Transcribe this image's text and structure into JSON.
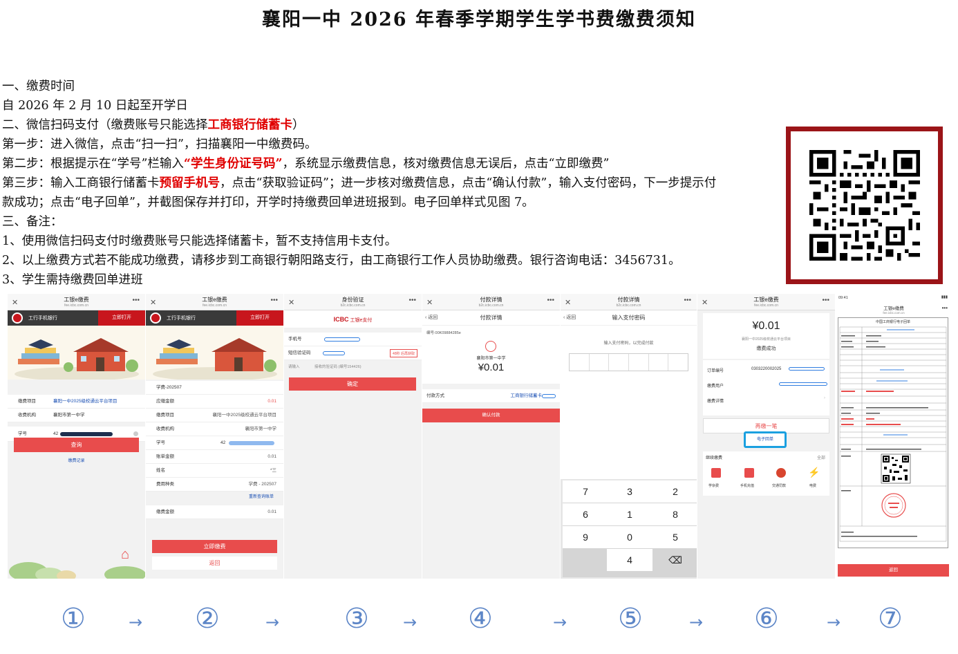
{
  "title": "襄阳一中 2026 年春季学期学生学书费缴费须知",
  "lines": {
    "l1": "一、缴费时间",
    "l2": "自 2026 年 2 月 10 日起至开学日",
    "l3a": " 二、微信扫码支付（缴费账号只能选择",
    "l3b": "工商银行储蓄卡",
    "l3c": "）",
    "l4": "第一步：进入微信，点击“扫一扫”，扫描襄阳一中缴费码。",
    "l5a": "第二步：根据提示在“学号”栏输入",
    "l5b": "“学生身份证号码”",
    "l5c": "，系统显示缴费信息，核对缴费信息无误后，点击“立即缴费”",
    "l6a": "第三步：输入工商银行储蓄卡",
    "l6b": "预留手机号",
    "l6c": "，点击“获取验证码”；进一步核对缴费信息，点击“确认付款”，输入支付密码，下一步提示付",
    "l7": "款成功；点击“电子回单”，并截图保存并打印，开学时持缴费回单进班报到。电子回单样式见图 7。",
    "l8": " 三、备注：",
    "l9": " 1、使用微信扫码支付时缴费账号只能选择储蓄卡，暂不支持信用卡支付。",
    "l10": " 2、以上缴费方式若不能成功缴费，请移步到工商银行朝阳路支行，由工商银行工作人员协助缴费。银行咨询电话：3456731。",
    "l11": " 3、学生需持缴费回单进班"
  },
  "phones": {
    "p1": {
      "title": "工银e缴费",
      "sub": "fee.icbc.com.cn",
      "bank": "工行手机银行",
      "open": "立即打开",
      "r1k": "缴费项目",
      "r1v": "襄阳一中2025级校通云平台项目",
      "r2k": "收费机构",
      "r2v": "襄阳市第一中学",
      "r3k": "学号",
      "r3v": "42",
      "btn": "查询",
      "link": "缴费记录"
    },
    "p2": {
      "title": "工银e缴费",
      "sub": "fee.icbc.com.cn",
      "bank": "工行手机银行",
      "open": "立即打开",
      "r0": "学费-202507",
      "r1k": "应缴金额",
      "r1v": "0.01",
      "r2k": "缴费项目",
      "r2v": "襄阳一中2025级校通云平台项目",
      "r3k": "收费机构",
      "r3v": "襄阳市第一中学",
      "r4k": "学号",
      "r4v": "42",
      "r5k": "账单金额",
      "r5v": "0.01",
      "r6k": "姓名",
      "r6v": "*三",
      "r7k": "费用种类",
      "r7v": "学费 - 202507",
      "link": "重新查询账单",
      "r8k": "缴费金额",
      "r8v": "0.01",
      "btn": "立即缴费",
      "back": "返回"
    },
    "p3": {
      "title": "身份验证",
      "sub": "b2c.icbc.com.cn",
      "logo": "ICBC",
      "pay": "工银e支付",
      "r1k": "手机号",
      "r2k": "短信验证码",
      "code": "48秒 后再获取",
      "hint": "请输入",
      "hint2": "接收的验证码 (编号154426)",
      "btn": "确定"
    },
    "p4": {
      "title": "付款详情",
      "sub": "b2c.icbc.com.cn",
      "back": "返回",
      "head": "付款详情",
      "order": "编号:00K09884285e",
      "org": "襄阳市第一中学",
      "amount": "¥0.01",
      "payway": "付款方式",
      "card": "工商银行储蓄卡",
      "btn": "确认付款"
    },
    "p5": {
      "title": "付款详情",
      "sub": "b2c.icbc.com.cn",
      "back": "返回",
      "head": "输入支付密码",
      "hint": "输入支付密码，以完成付款",
      "k1": "7",
      "k2": "3",
      "k3": "2",
      "k4": "6",
      "k5": "1",
      "k6": "8",
      "k7": "9",
      "k8": "0",
      "k9": "5",
      "k10": "4",
      "kdel": "⌫"
    },
    "p6": {
      "title": "工银e缴费",
      "sub": "fee.icbc.com.cn",
      "amount": "¥0.01",
      "proj": "襄阳一中2025级校通云平台项目",
      "ok": "缴费成功",
      "r1k": "订单编号",
      "r1v": "0303220002025",
      "r2k": "缴费用户",
      "r3k": "缴费详情",
      "again": "再缴一笔",
      "receipt": "电子回单",
      "more": "继续缴费",
      "all": "全部",
      "i1": "学杂费",
      "i2": "手机充值",
      "i3": "交通罚款",
      "i4": "电费"
    },
    "p7": {
      "time": "09:41",
      "title": "工银e缴费",
      "sub": "fee.icbc.com.cn",
      "head": "中国工商银行电子回单",
      "btn": "返回"
    }
  },
  "steps": [
    "①",
    "②",
    "③",
    "④",
    "⑤",
    "⑥",
    "⑦"
  ],
  "arrow": "→"
}
